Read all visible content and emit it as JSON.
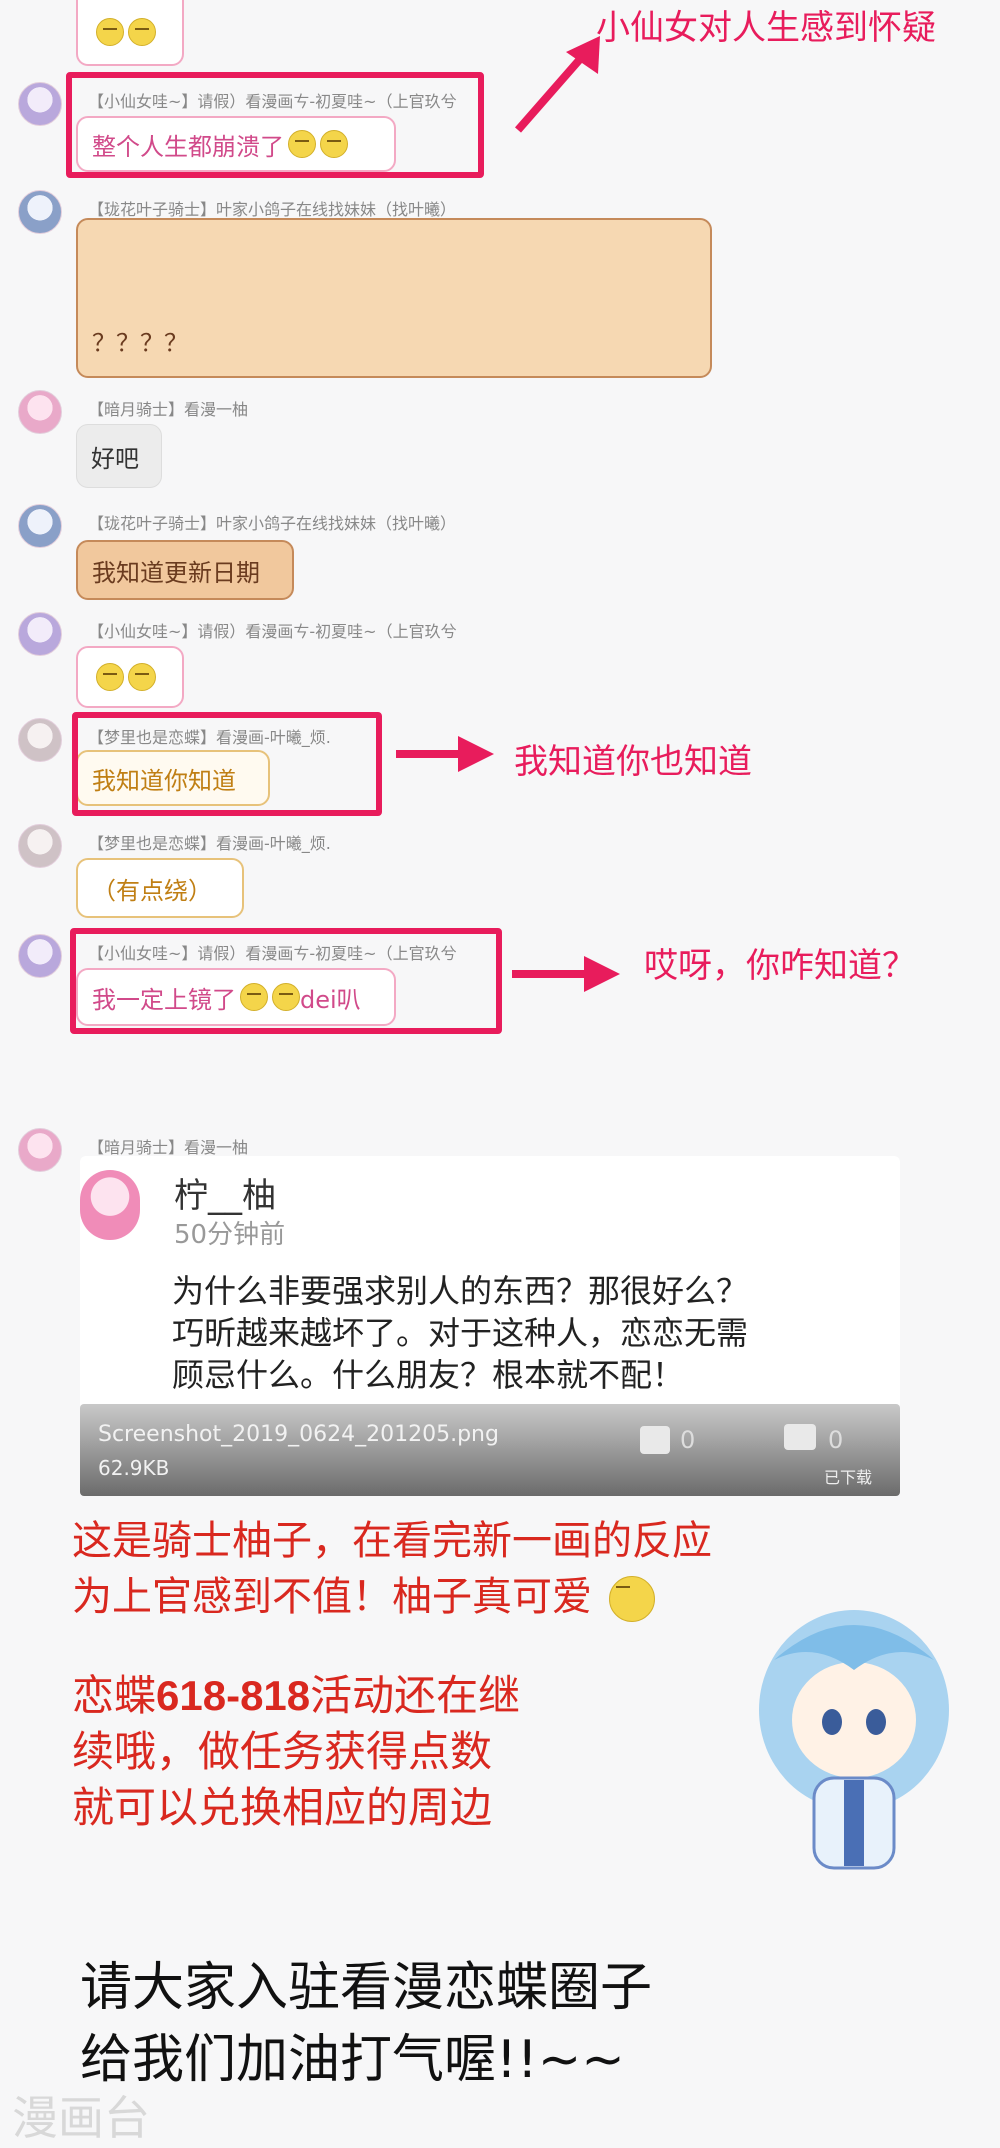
{
  "colors": {
    "highlight": "#e81c5c",
    "promo_red": "#d9281f",
    "bubble_pink": "#f3a9c4",
    "bubble_brown": "#f6d8b2"
  },
  "chat": [
    {
      "sender": "【小仙女哇~】请假）看漫画ㄘ-初夏哇~（上官玖兮",
      "text": "整个人生都崩溃了"
    },
    {
      "sender": "【珑花叶子骑士】叶家小鸽子在线找妹妹（找叶曦）",
      "text": "？？？？"
    },
    {
      "sender": "【暗月骑士】看漫一柚",
      "text": "好吧"
    },
    {
      "sender": "【珑花叶子骑士】叶家小鸽子在线找妹妹（找叶曦）",
      "text": "我知道更新日期"
    },
    {
      "sender": "【小仙女哇~】请假）看漫画ㄘ-初夏哇~（上官玖兮",
      "text": ""
    },
    {
      "sender": "【梦里也是恋蝶】看漫画-叶曦_烦.",
      "text": "我知道你知道"
    },
    {
      "sender": "【梦里也是恋蝶】看漫画-叶曦_烦.",
      "text": "（有点绕）"
    },
    {
      "sender": "【小仙女哇~】请假）看漫画ㄘ-初夏哇~（上官玖兮",
      "text": "我一定上镜了",
      "suffix": "dei叭"
    },
    {
      "sender": "【暗月骑士】看漫一柚",
      "text": ""
    }
  ],
  "annotations": {
    "a1": "小仙女对人生感到怀疑",
    "a2": "我知道你也知道",
    "a3": "哎呀，你咋知道？"
  },
  "post": {
    "author": "柠__柚",
    "time": "50分钟前",
    "body_1": "为什么非要强求别人的东西？那很好么？",
    "body_2": "巧昕越来越坏了。对于这种人，恋恋无需",
    "body_3": "顾忌什么。什么朋友？根本就不配！",
    "file_name": "Screenshot_2019_0624_201205.png",
    "file_size": "62.9KB",
    "like_count": "0",
    "comment_count": "0",
    "downloaded": "已下载"
  },
  "promo": {
    "line1": "这是骑士柚子，在看完新一画的反应",
    "line2": "为上官感到不值！柚子真可爱",
    "line3a": "恋蝶",
    "line3b": "618-818",
    "line3c": "活动还在继",
    "line4": "续哦，做任务获得点数",
    "line5": "就可以兑换相应的周边"
  },
  "footer": {
    "line1": "请大家入驻看漫恋蝶圈子",
    "line2": "给我们加油打气喔!!~~",
    "watermark": "漫画台"
  }
}
